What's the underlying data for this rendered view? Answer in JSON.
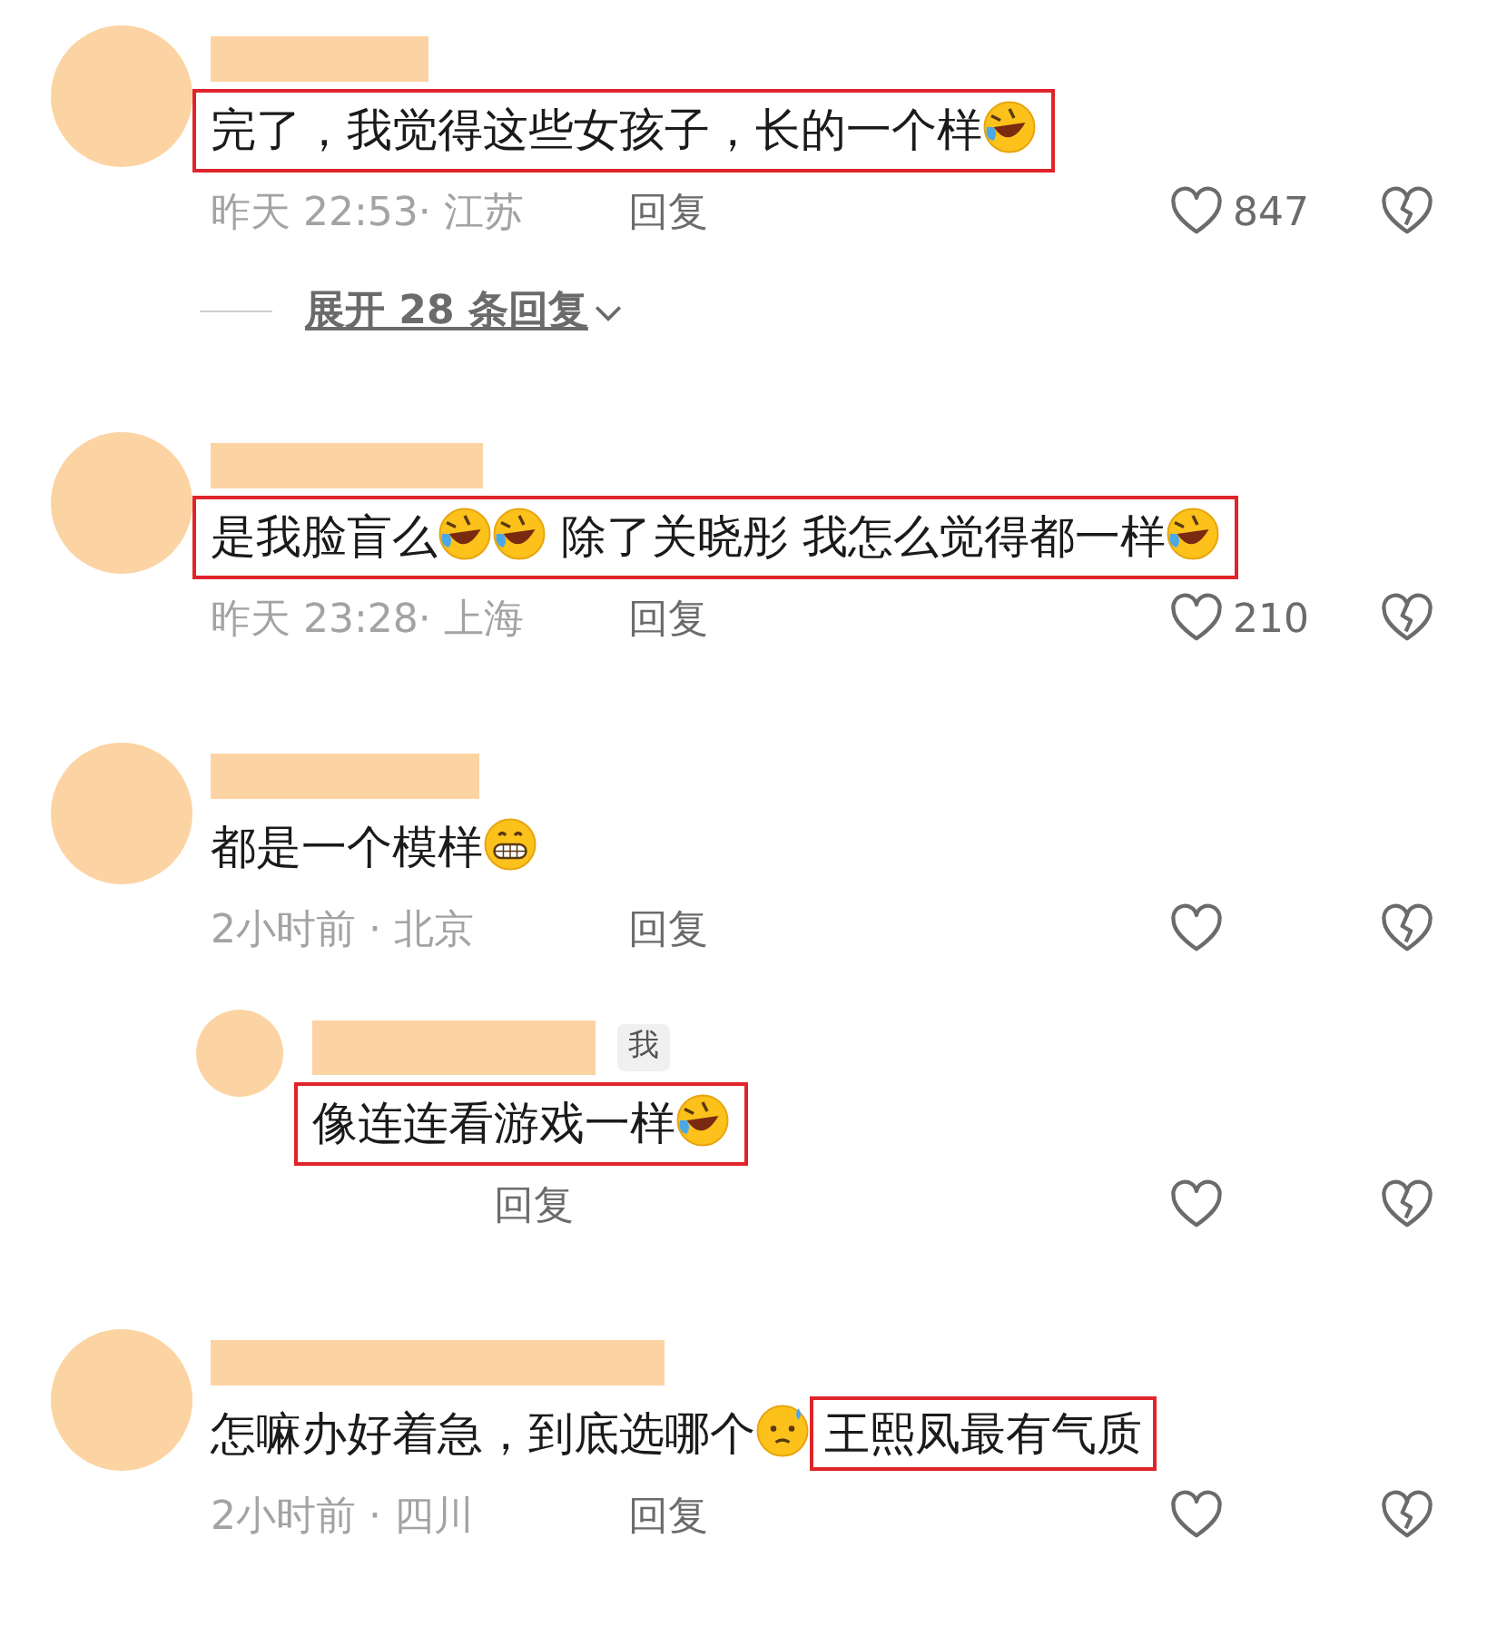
{
  "comments": [
    {
      "content": [
        {
          "highlighted": true,
          "segments": [
            {
              "kind": "text",
              "text": "完了，我觉得这些女孩子，长的一个样"
            },
            {
              "kind": "laugh"
            }
          ]
        }
      ],
      "meta": "昨天 22:53· 江苏",
      "reply_label": "回复",
      "likes": "847",
      "expand": "展开 28 条回复"
    },
    {
      "content": [
        {
          "highlighted": true,
          "segments": [
            {
              "kind": "text",
              "text": "是我脸盲么"
            },
            {
              "kind": "laugh"
            },
            {
              "kind": "laugh"
            },
            {
              "kind": "text",
              "text": " 除了关晓彤 我怎么觉得都一样"
            },
            {
              "kind": "laugh"
            }
          ]
        }
      ],
      "meta": "昨天 23:28· 上海",
      "reply_label": "回复",
      "likes": "210"
    },
    {
      "content": [
        {
          "highlighted": false,
          "segments": [
            {
              "kind": "text",
              "text": "都是一个模样"
            },
            {
              "kind": "grin"
            }
          ]
        }
      ],
      "meta": "2小时前 · 北京",
      "reply_label": "回复",
      "replies": [
        {
          "badge": "我",
          "content": [
            {
              "highlighted": true,
              "segments": [
                {
                  "kind": "text",
                  "text": "像连连看游戏一样"
                },
                {
                  "kind": "laugh"
                }
              ]
            }
          ],
          "reply_label": "回复"
        }
      ]
    },
    {
      "content": [
        {
          "highlighted": false,
          "segments": [
            {
              "kind": "text",
              "text": "怎嘛办好着急，到底选哪个"
            },
            {
              "kind": "sweat"
            }
          ]
        },
        {
          "highlighted": true,
          "segments": [
            {
              "kind": "text",
              "text": "王熙凤最有气质"
            }
          ]
        }
      ],
      "meta": "2小时前 · 四川",
      "reply_label": "回复"
    }
  ]
}
